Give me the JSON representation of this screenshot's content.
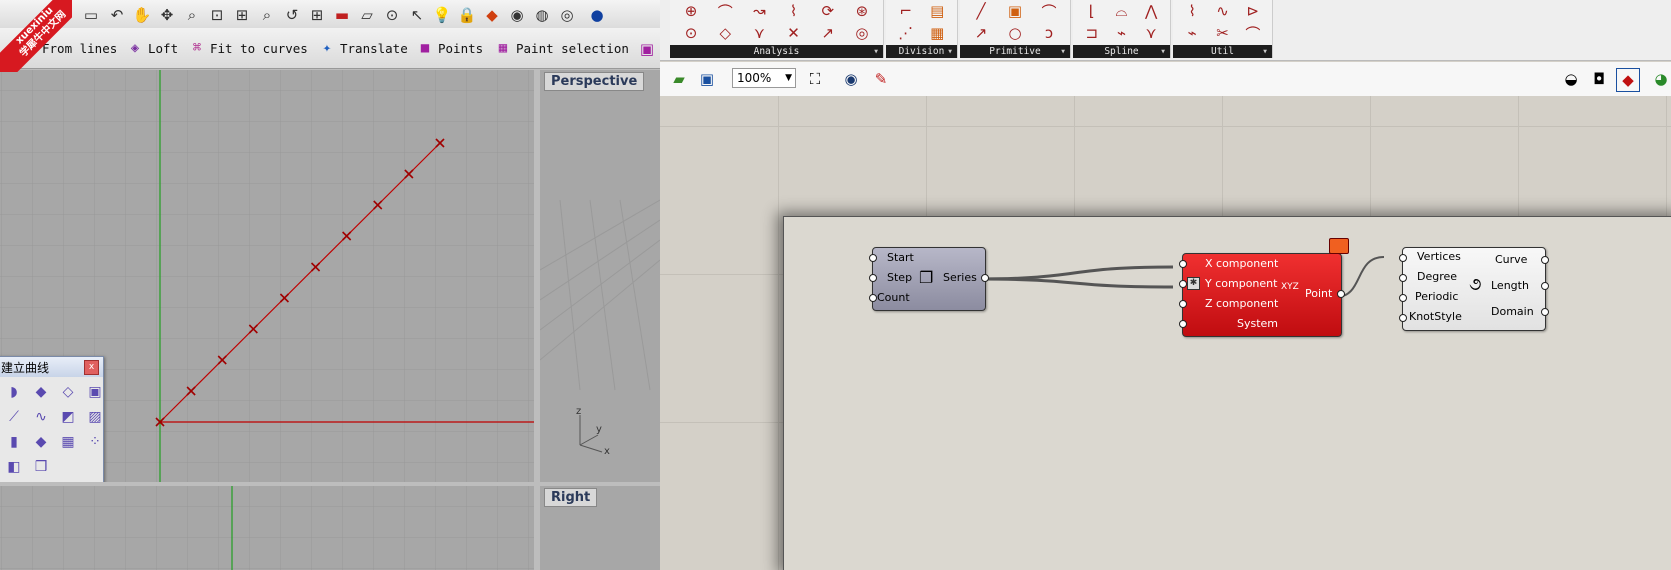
{
  "watermark": {
    "line1": "xuexiniu",
    "line2": "学犀牛中文网"
  },
  "rhino": {
    "toolbar2": [
      {
        "label": "From lines",
        "icon": "surface-from-lines-icon"
      },
      {
        "label": "Loft",
        "icon": "loft-icon"
      },
      {
        "label": "Fit to curves",
        "icon": "fit-to-curves-icon"
      },
      {
        "label": "Translate",
        "icon": "translate-icon"
      },
      {
        "label": "Points",
        "icon": "points-icon"
      },
      {
        "label": "Paint selection",
        "icon": "paint-selection-icon"
      }
    ],
    "viewports": {
      "perspective": "Perspective",
      "right": "Right"
    },
    "axis_labels": {
      "z": "z",
      "y": "y",
      "x": "x"
    },
    "popup": {
      "title": "建立曲线",
      "close": "x"
    }
  },
  "grasshopper": {
    "ribbon_panels": [
      "Analysis",
      "Division",
      "Primitive",
      "Spline",
      "Util"
    ],
    "zoom": "100%",
    "components": {
      "series": {
        "inputs": [
          "Start",
          "Step",
          "Count"
        ],
        "output": "Series"
      },
      "point": {
        "inputs": [
          "X component",
          "Y component",
          "Z component",
          "System"
        ],
        "output": "Point",
        "icon_label": "XYZ"
      },
      "curve": {
        "inputs": [
          "Vertices",
          "Degree",
          "Periodic",
          "KnotStyle"
        ],
        "outputs": [
          "Curve",
          "Length",
          "Domain"
        ]
      }
    }
  },
  "colors": {
    "point_component": "#e0141a",
    "series_component": "#a0a0b0",
    "curve_component": "#f0f0f0",
    "grid_red": "#c00000",
    "axis_green": "#2ca02c"
  }
}
